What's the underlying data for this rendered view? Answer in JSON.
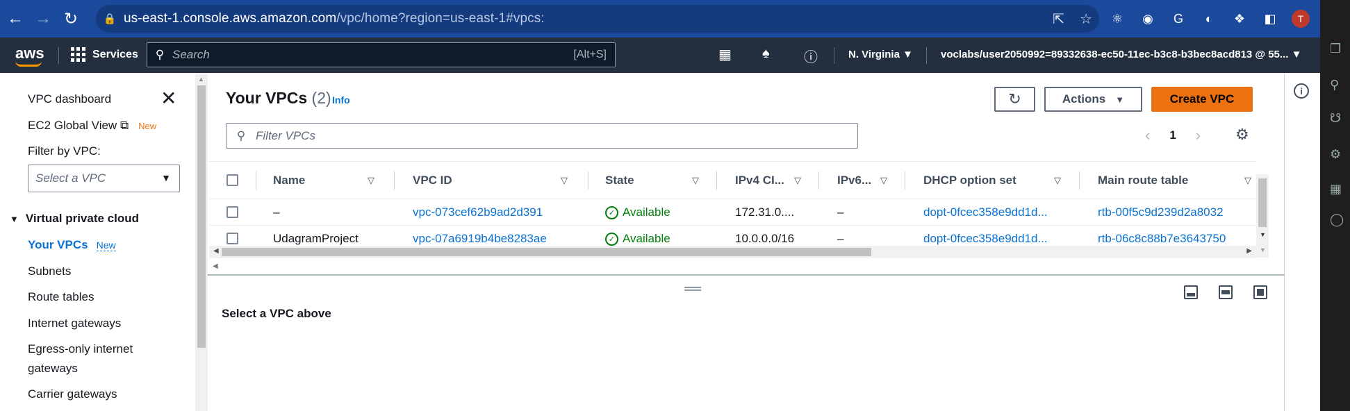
{
  "browser": {
    "url_host": "us-east-1.console.aws.amazon.com",
    "url_path": "/vpc/home?region=us-east-1#vpcs:",
    "profile_initial": "T"
  },
  "header": {
    "logo": "aws",
    "services": "Services",
    "search_placeholder": "Search",
    "search_shortcut": "[Alt+S]",
    "region": "N. Virginia ▼",
    "account": "voclabs/user2050992=89332638-ec50-11ec-b3c8-b3bec8acd813 @ 55... ▼"
  },
  "sidebar": {
    "dashboard": "VPC dashboard",
    "global_view": "EC2 Global View",
    "global_view_badge": "New",
    "filter_label": "Filter by VPC:",
    "filter_placeholder": "Select a VPC",
    "section": "Virtual private cloud",
    "items": [
      {
        "label": "Your VPCs",
        "badge": "New"
      },
      {
        "label": "Subnets"
      },
      {
        "label": "Route tables"
      },
      {
        "label": "Internet gateways"
      },
      {
        "label": "Egress-only internet"
      },
      {
        "label": "gateways"
      },
      {
        "label": "Carrier gateways"
      }
    ]
  },
  "main": {
    "title": "Your VPCs",
    "count": "(2)",
    "info": "Info",
    "actions": "Actions",
    "create": "Create VPC",
    "filter_placeholder": "Filter VPCs",
    "page": "1",
    "columns": [
      "Name",
      "VPC ID",
      "State",
      "IPv4 CI...",
      "IPv6...",
      "DHCP option set",
      "Main route table"
    ],
    "rows": [
      {
        "name": "–",
        "vpc_id": "vpc-073cef62b9ad2d391",
        "state": "Available",
        "ipv4": "172.31.0....",
        "ipv6": "–",
        "dhcp": "dopt-0fcec358e9dd1d...",
        "route": "rtb-00f5c9d239d2a8032"
      },
      {
        "name": "UdagramProject",
        "vpc_id": "vpc-07a6919b4be8283ae",
        "state": "Available",
        "ipv4": "10.0.0.0/16",
        "ipv6": "–",
        "dhcp": "dopt-0fcec358e9dd1d...",
        "route": "rtb-06c8c88b7e3643750"
      }
    ],
    "detail_message": "Select a VPC above"
  },
  "colors": {
    "browser_bar": "#1b4a9c",
    "aws_header": "#232f3e",
    "accent_orange": "#ec7211",
    "link_blue": "#0972d3",
    "success_green": "#037f0c"
  }
}
